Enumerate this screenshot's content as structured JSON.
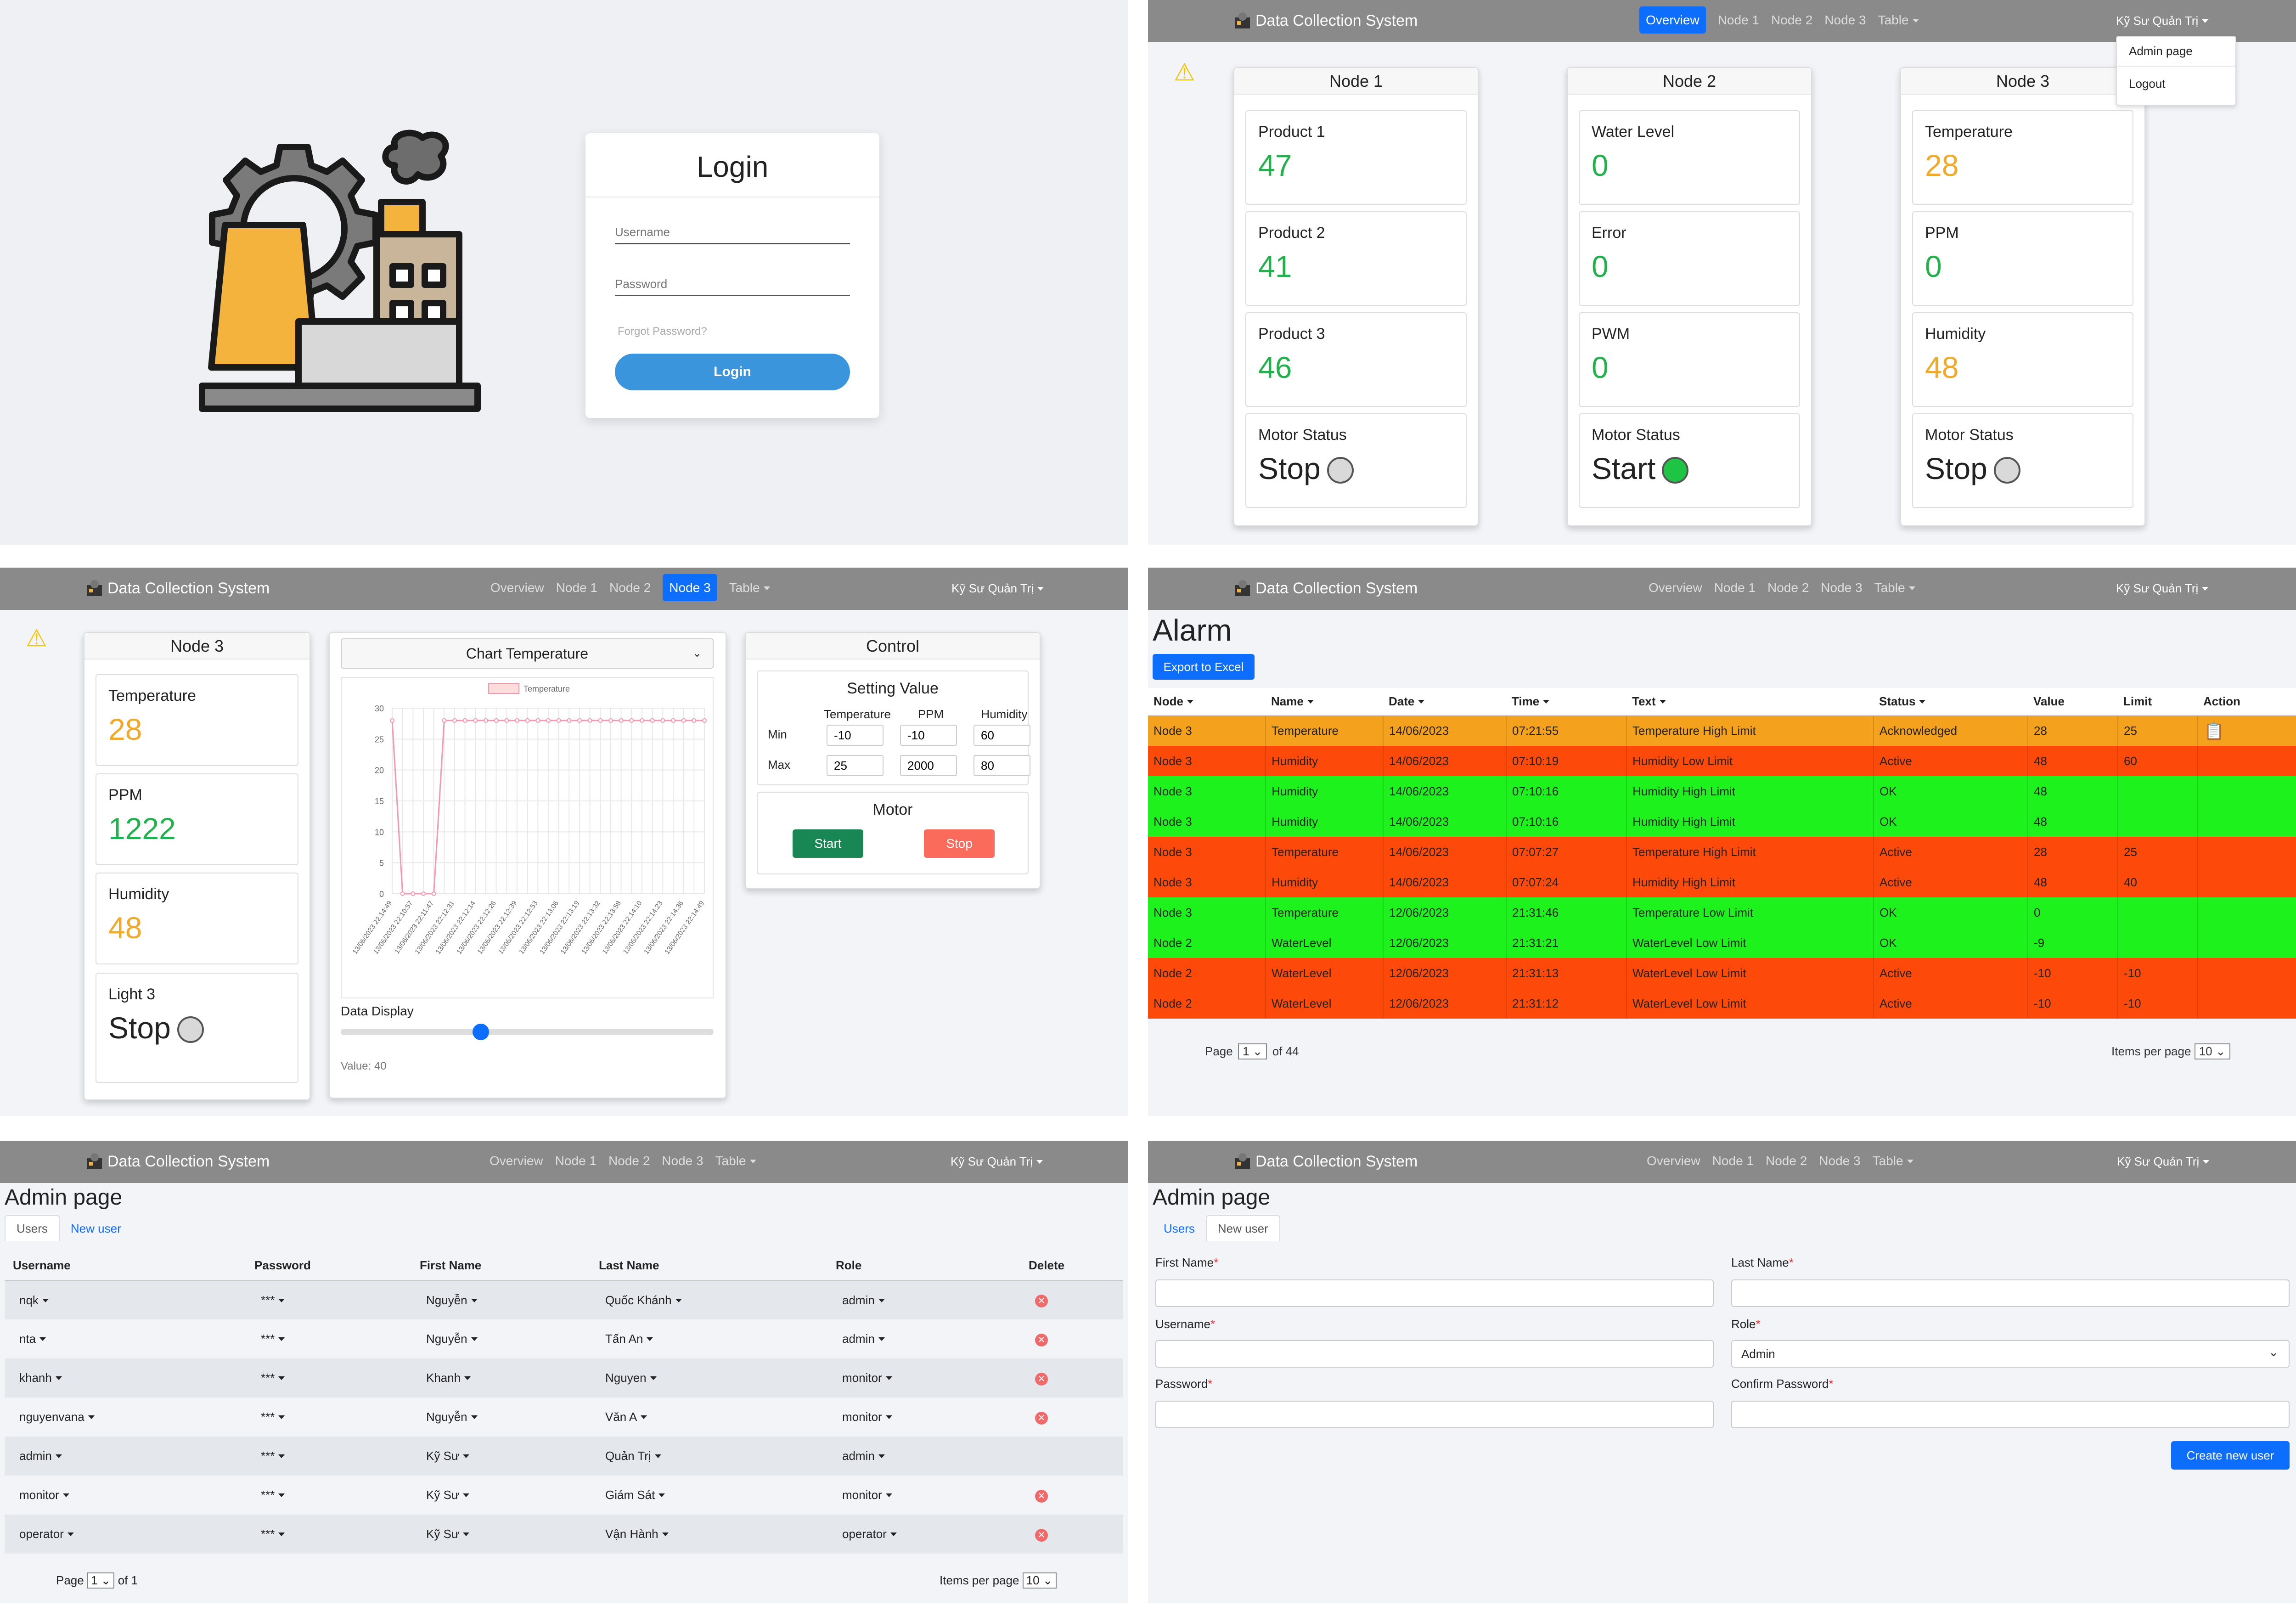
{
  "brand": "Data Collection System",
  "nav": {
    "overview": "Overview",
    "node1": "Node 1",
    "node2": "Node 2",
    "node3": "Node 3",
    "table": "Table",
    "user": "Kỹ Sư Quản Trị"
  },
  "login": {
    "title": "Login",
    "username_ph": "Username",
    "password_ph": "Password",
    "forgot": "Forgot Password?",
    "button": "Login"
  },
  "dropdown": {
    "admin": "Admin page",
    "logout": "Logout"
  },
  "overview": {
    "nodes": [
      {
        "title": "Node 1",
        "tiles": [
          {
            "label": "Product 1",
            "value": "47",
            "color": "green"
          },
          {
            "label": "Product 2",
            "value": "41",
            "color": "green"
          },
          {
            "label": "Product 3",
            "value": "46",
            "color": "green"
          }
        ],
        "motor_label": "Motor Status",
        "motor_value": "Stop",
        "motor_on": false
      },
      {
        "title": "Node 2",
        "tiles": [
          {
            "label": "Water Level",
            "value": "0",
            "color": "green"
          },
          {
            "label": "Error",
            "value": "0",
            "color": "green"
          },
          {
            "label": "PWM",
            "value": "0",
            "color": "green"
          }
        ],
        "motor_label": "Motor Status",
        "motor_value": "Start",
        "motor_on": true
      },
      {
        "title": "Node 3",
        "tiles": [
          {
            "label": "Temperature",
            "value": "28",
            "color": "orange"
          },
          {
            "label": "PPM",
            "value": "0",
            "color": "green"
          },
          {
            "label": "Humidity",
            "value": "48",
            "color": "orange"
          }
        ],
        "motor_label": "Motor Status",
        "motor_value": "Stop",
        "motor_on": false
      }
    ]
  },
  "node3": {
    "title": "Node 3",
    "tiles": [
      {
        "label": "Temperature",
        "value": "28",
        "color": "orange"
      },
      {
        "label": "PPM",
        "value": "1222",
        "color": "green"
      },
      {
        "label": "Humidity",
        "value": "48",
        "color": "orange"
      }
    ],
    "light_label": "Light 3",
    "light_value": "Stop",
    "chart_select": "Chart Temperature",
    "legend": "Temperature",
    "data_display": "Data Display",
    "slider_value": "Value: 40",
    "slider_level": 0.37,
    "control": {
      "title": "Control",
      "setting": "Setting Value",
      "cols": [
        "Temperature",
        "PPM",
        "Humidity"
      ],
      "min_label": "Min",
      "max_label": "Max",
      "min": [
        "-10",
        "-10",
        "60"
      ],
      "max": [
        "25",
        "2000",
        "80"
      ],
      "motor": "Motor",
      "start": "Start",
      "stop": "Stop"
    }
  },
  "chart_data": {
    "type": "line",
    "series": [
      {
        "name": "Temperature",
        "values": [
          28,
          0,
          0,
          0,
          0,
          28,
          28,
          28,
          28,
          28,
          28,
          28,
          28,
          28,
          28,
          28,
          28,
          28,
          28,
          28,
          28,
          28,
          28,
          28,
          28,
          28,
          28,
          28,
          28,
          28,
          28
        ]
      }
    ],
    "x": [
      "13/06/2023 22:14:49",
      "13/06/2023 22:10:57",
      "13/06/2023 22:11:47",
      "13/06/2023 22:12:31",
      "13/06/2023 22:12:14",
      "13/06/2023 22:12:26",
      "13/06/2023 22:12:39",
      "13/06/2023 22:12:53",
      "13/06/2023 22:13:06",
      "13/06/2023 22:13:19",
      "13/06/2023 22:13:32",
      "13/06/2023 22:13:58",
      "13/06/2023 22:14:10",
      "13/06/2023 22:14:23",
      "13/06/2023 22:14:36",
      "13/06/2023 22:14:49"
    ],
    "yticks": [
      "0",
      "5",
      "10",
      "15",
      "20",
      "25",
      "30"
    ],
    "ylim": [
      0,
      30
    ],
    "grid": true,
    "legend": "top"
  },
  "alarm": {
    "title": "Alarm",
    "export": "Export to Excel",
    "headers": [
      "Node",
      "Name",
      "Date",
      "Time",
      "Text",
      "Status",
      "Value",
      "Limit",
      "Action"
    ],
    "rows": [
      [
        "Node 3",
        "Temperature",
        "14/06/2023",
        "07:21:55",
        "Temperature High Limit",
        "Acknowledged",
        "28",
        "25"
      ],
      [
        "Node 3",
        "Humidity",
        "14/06/2023",
        "07:10:19",
        "Humidity Low Limit",
        "Active",
        "48",
        "60"
      ],
      [
        "Node 3",
        "Humidity",
        "14/06/2023",
        "07:10:16",
        "Humidity High Limit",
        "OK",
        "48",
        ""
      ],
      [
        "Node 3",
        "Humidity",
        "14/06/2023",
        "07:10:16",
        "Humidity High Limit",
        "OK",
        "48",
        ""
      ],
      [
        "Node 3",
        "Temperature",
        "14/06/2023",
        "07:07:27",
        "Temperature High Limit",
        "Active",
        "28",
        "25"
      ],
      [
        "Node 3",
        "Humidity",
        "14/06/2023",
        "07:07:24",
        "Humidity High Limit",
        "Active",
        "48",
        "40"
      ],
      [
        "Node 3",
        "Temperature",
        "12/06/2023",
        "21:31:46",
        "Temperature Low Limit",
        "OK",
        "0",
        ""
      ],
      [
        "Node 2",
        "WaterLevel",
        "12/06/2023",
        "21:31:21",
        "WaterLevel Low Limit",
        "OK",
        "-9",
        ""
      ],
      [
        "Node 2",
        "WaterLevel",
        "12/06/2023",
        "21:31:13",
        "WaterLevel Low Limit",
        "Active",
        "-10",
        "-10"
      ],
      [
        "Node 2",
        "WaterLevel",
        "12/06/2023",
        "21:31:12",
        "WaterLevel Low Limit",
        "Active",
        "-10",
        "-10"
      ]
    ],
    "colors": {
      "Acknowledged": "#f4a11e",
      "Active": "#fd4a0a",
      "OK": "#1ef21c"
    },
    "page_label": "Page",
    "page": "1",
    "of": "of 44",
    "ipp_label": "Items per page",
    "ipp": "10"
  },
  "admin": {
    "title": "Admin page",
    "tab_users": "Users",
    "tab_new": "New user",
    "headers": [
      "Username",
      "Password",
      "First Name",
      "Last Name",
      "Role",
      "Delete"
    ],
    "rows": [
      [
        "nqk",
        "***",
        "Nguyễn",
        "Quốc Khánh",
        "admin",
        true
      ],
      [
        "nta",
        "***",
        "Nguyễn",
        "Tấn An",
        "admin",
        true
      ],
      [
        "khanh",
        "***",
        "Khanh",
        "Nguyen",
        "monitor",
        true
      ],
      [
        "nguyenvana",
        "***",
        "Nguyễn",
        "Văn A",
        "monitor",
        true
      ],
      [
        "admin",
        "***",
        "Kỹ Sư",
        "Quản Trị",
        "admin",
        false
      ],
      [
        "monitor",
        "***",
        "Kỹ Sư",
        "Giám Sát",
        "monitor",
        true
      ],
      [
        "operator",
        "***",
        "Kỹ Sư",
        "Vận Hành",
        "operator",
        true
      ]
    ],
    "page_label": "Page",
    "page": "1",
    "of": "of 1",
    "ipp_label": "Items per page",
    "ipp": "10"
  },
  "newuser": {
    "first": "First Name",
    "last": "Last Name",
    "username": "Username",
    "role": "Role",
    "role_value": "Admin",
    "password": "Password",
    "confirm": "Confirm Password",
    "create": "Create new user",
    "required": "*"
  }
}
